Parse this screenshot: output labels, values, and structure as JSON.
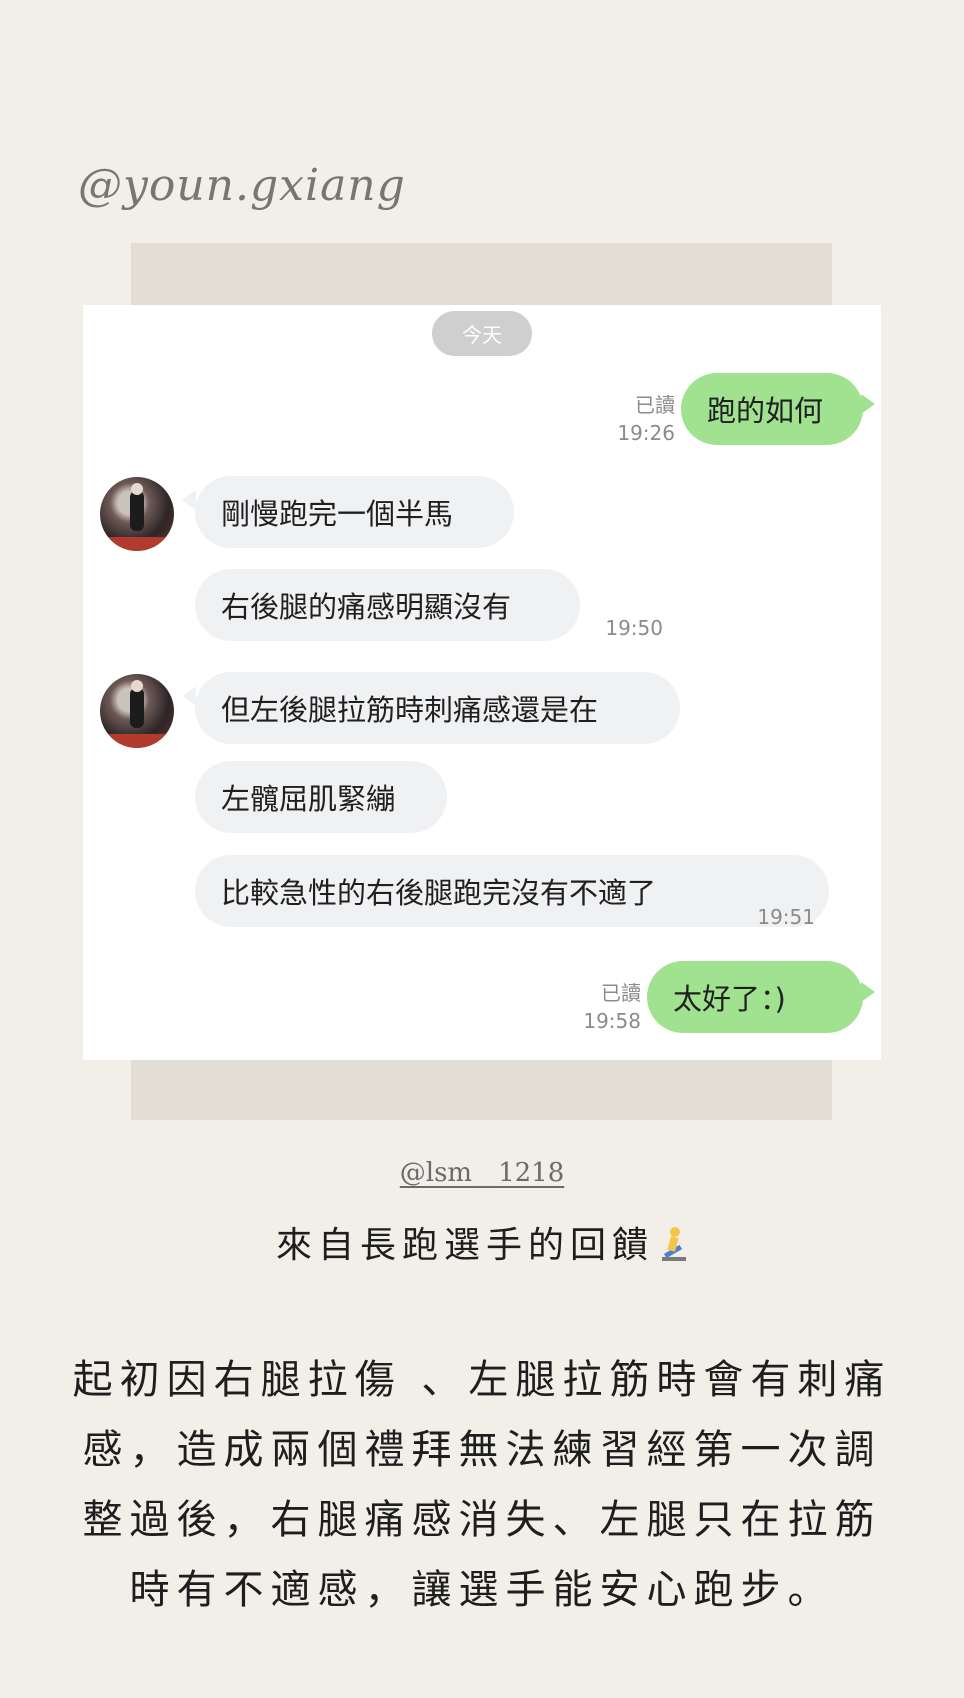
{
  "story": {
    "handle": "@youn.gxiang",
    "credit": "@lsm__1218",
    "headline": "來自長跑選手的回饋",
    "headline_emoji": "runner-icon",
    "body_lines": [
      "起初因右腿拉傷 、左腿拉筋時會有刺痛",
      "感，造成兩個禮拜無法練習經第一次調",
      "整過後，右腿痛感消失、左腿只在拉筋",
      "時有不適感，讓選手能安心跑步。"
    ]
  },
  "chat": {
    "date_label": "今天",
    "messages": [
      {
        "dir": "out",
        "text": "跑的如何",
        "read": "已讀",
        "time": "19:26"
      },
      {
        "dir": "in",
        "text": "剛慢跑完一個半馬"
      },
      {
        "dir": "in",
        "text": "右後腿的痛感明顯沒有",
        "time": "19:50"
      },
      {
        "dir": "in",
        "text": "但左後腿拉筋時刺痛感還是在"
      },
      {
        "dir": "in",
        "text": "左髖屈肌緊繃"
      },
      {
        "dir": "in",
        "text": "比較急性的右後腿跑完沒有不適了",
        "time": "19:51"
      },
      {
        "dir": "out",
        "text": "太好了：)",
        "read": "已讀",
        "time": "19:58"
      }
    ]
  },
  "colors": {
    "background": "#f2efe9",
    "outgoing_bubble": "#a1e291",
    "incoming_bubble": "#f0f1f3"
  }
}
